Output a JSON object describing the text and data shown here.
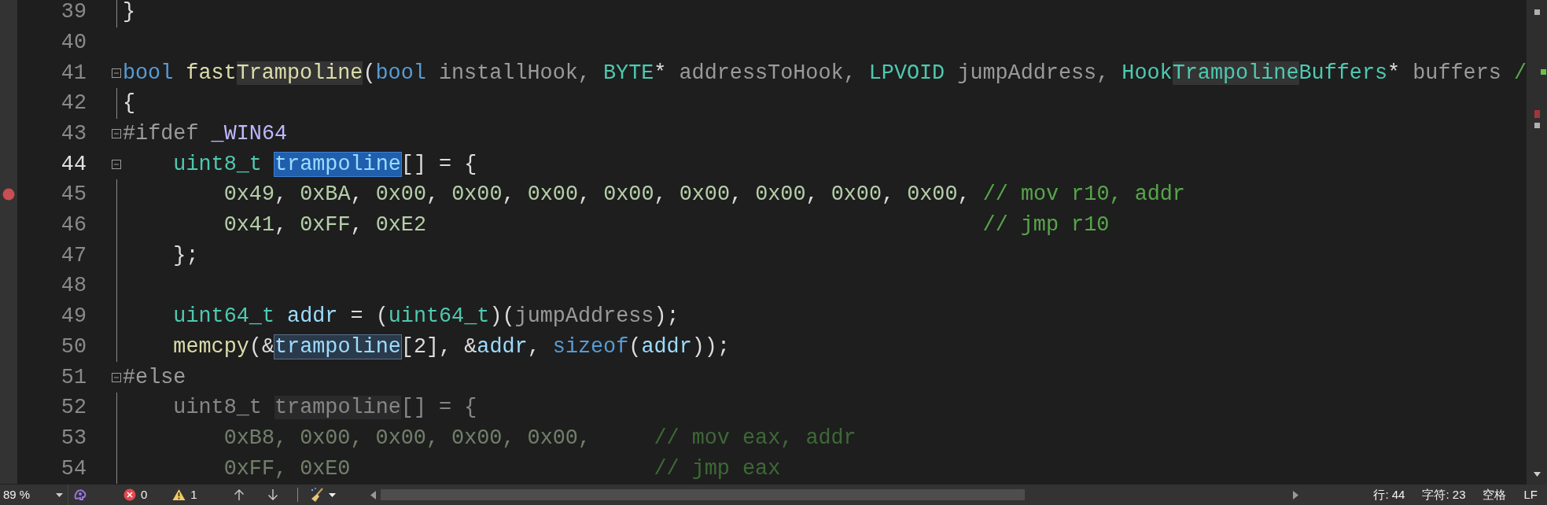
{
  "lines": [
    {
      "number": "39",
      "current": false,
      "breakpoint": false,
      "foldable": false,
      "fold_guide": true,
      "inactive": false,
      "tokens": [
        {
          "text": "}",
          "kind": "plain"
        }
      ]
    },
    {
      "number": "40",
      "current": false,
      "breakpoint": false,
      "foldable": false,
      "fold_guide": false,
      "inactive": false
    },
    {
      "number": "41",
      "current": false,
      "breakpoint": false,
      "foldable": true,
      "fold_guide": false,
      "inactive": false,
      "tokens": [
        {
          "text": "bool",
          "kind": "keyword"
        },
        {
          "text": " fast",
          "kind": "function"
        },
        {
          "text": "Trampoline",
          "kind": "function",
          "matched": true
        },
        {
          "text": "(",
          "kind": "plain"
        },
        {
          "text": "bool",
          "kind": "keyword"
        },
        {
          "text": " installHook, ",
          "kind": "param"
        },
        {
          "text": "BYTE",
          "kind": "type"
        },
        {
          "text": "* ",
          "kind": "plain"
        },
        {
          "text": "addressToHook, ",
          "kind": "param"
        },
        {
          "text": "LPVOID",
          "kind": "type"
        },
        {
          "text": " jumpAddress, ",
          "kind": "param"
        },
        {
          "text": "Hook",
          "kind": "type"
        },
        {
          "text": "Trampoline",
          "kind": "type",
          "matched": true
        },
        {
          "text": "Buffers",
          "kind": "type"
        },
        {
          "text": "* ",
          "kind": "plain"
        },
        {
          "text": "buffers ",
          "kind": "param"
        },
        {
          "text": "/",
          "kind": "comment"
        }
      ]
    },
    {
      "number": "42",
      "current": false,
      "breakpoint": false,
      "foldable": false,
      "fold_guide": true,
      "inactive": false,
      "tokens": [
        {
          "text": "{",
          "kind": "plain"
        }
      ]
    },
    {
      "number": "43",
      "current": false,
      "breakpoint": false,
      "foldable": true,
      "fold_guide": false,
      "inactive": false,
      "tokens": [
        {
          "text": "#ifdef ",
          "kind": "preprocessor"
        },
        {
          "text": "_WIN64",
          "kind": "macro"
        }
      ]
    },
    {
      "number": "44",
      "current": true,
      "breakpoint": false,
      "foldable": true,
      "fold_guide": false,
      "inactive": false,
      "tokens": [
        {
          "text": "    uint8_t ",
          "kind": "type"
        },
        {
          "text": "trampoline",
          "kind": "variable",
          "selected": true
        },
        {
          "text": "[] = {",
          "kind": "plain"
        }
      ]
    },
    {
      "number": "45",
      "current": false,
      "breakpoint": true,
      "foldable": false,
      "fold_guide": true,
      "inactive": false,
      "tokens": [
        {
          "text": "        0x49",
          "kind": "number"
        },
        {
          "text": ", ",
          "kind": "plain"
        },
        {
          "text": "0xBA",
          "kind": "number"
        },
        {
          "text": ", ",
          "kind": "plain"
        },
        {
          "text": "0x00",
          "kind": "number"
        },
        {
          "text": ", ",
          "kind": "plain"
        },
        {
          "text": "0x00",
          "kind": "number"
        },
        {
          "text": ", ",
          "kind": "plain"
        },
        {
          "text": "0x00",
          "kind": "number"
        },
        {
          "text": ", ",
          "kind": "plain"
        },
        {
          "text": "0x00",
          "kind": "number"
        },
        {
          "text": ", ",
          "kind": "plain"
        },
        {
          "text": "0x00",
          "kind": "number"
        },
        {
          "text": ", ",
          "kind": "plain"
        },
        {
          "text": "0x00",
          "kind": "number"
        },
        {
          "text": ", ",
          "kind": "plain"
        },
        {
          "text": "0x00",
          "kind": "number"
        },
        {
          "text": ", ",
          "kind": "plain"
        },
        {
          "text": "0x00",
          "kind": "number"
        },
        {
          "text": ", ",
          "kind": "plain"
        },
        {
          "text": "// mov r10, addr",
          "kind": "comment"
        }
      ]
    },
    {
      "number": "46",
      "current": false,
      "breakpoint": false,
      "foldable": false,
      "fold_guide": true,
      "inactive": false,
      "tokens": [
        {
          "text": "        0x41",
          "kind": "number"
        },
        {
          "text": ", ",
          "kind": "plain"
        },
        {
          "text": "0xFF",
          "kind": "number"
        },
        {
          "text": ", ",
          "kind": "plain"
        },
        {
          "text": "0xE2                                            ",
          "kind": "number"
        },
        {
          "text": "// jmp r10",
          "kind": "comment"
        }
      ]
    },
    {
      "number": "47",
      "current": false,
      "breakpoint": false,
      "foldable": false,
      "fold_guide": true,
      "inactive": false,
      "tokens": [
        {
          "text": "    };",
          "kind": "plain"
        }
      ]
    },
    {
      "number": "48",
      "current": false,
      "breakpoint": false,
      "foldable": false,
      "fold_guide": true,
      "inactive": false
    },
    {
      "number": "49",
      "current": false,
      "breakpoint": false,
      "foldable": false,
      "fold_guide": true,
      "inactive": false,
      "tokens": [
        {
          "text": "    uint64_t ",
          "kind": "type"
        },
        {
          "text": "addr",
          "kind": "variable"
        },
        {
          "text": " = (",
          "kind": "plain"
        },
        {
          "text": "uint64_t",
          "kind": "type"
        },
        {
          "text": ")(",
          "kind": "plain"
        },
        {
          "text": "jumpAddress",
          "kind": "param"
        },
        {
          "text": ");",
          "kind": "plain"
        }
      ]
    },
    {
      "number": "50",
      "current": false,
      "breakpoint": false,
      "foldable": false,
      "fold_guide": true,
      "inactive": false,
      "tokens": [
        {
          "text": "    memcpy",
          "kind": "function"
        },
        {
          "text": "(&",
          "kind": "plain"
        },
        {
          "text": "trampoline",
          "kind": "variable",
          "referenced": true
        },
        {
          "text": "[2], &",
          "kind": "plain"
        },
        {
          "text": "addr",
          "kind": "variable"
        },
        {
          "text": ", ",
          "kind": "plain"
        },
        {
          "text": "sizeof",
          "kind": "keyword"
        },
        {
          "text": "(",
          "kind": "plain"
        },
        {
          "text": "addr",
          "kind": "variable"
        },
        {
          "text": "));",
          "kind": "plain"
        }
      ]
    },
    {
      "number": "51",
      "current": false,
      "breakpoint": false,
      "foldable": true,
      "fold_guide": false,
      "inactive": false,
      "tokens": [
        {
          "text": "#else",
          "kind": "preprocessor"
        }
      ]
    },
    {
      "number": "52",
      "current": false,
      "breakpoint": false,
      "foldable": false,
      "fold_guide": true,
      "inactive": true,
      "tokens": [
        {
          "text": "    uint8_t ",
          "kind": "plain"
        },
        {
          "text": "trampoline",
          "kind": "plain",
          "matched": true
        },
        {
          "text": "[] = {",
          "kind": "plain"
        }
      ]
    },
    {
      "number": "53",
      "current": false,
      "breakpoint": false,
      "foldable": false,
      "fold_guide": true,
      "inactive": true,
      "tokens": [
        {
          "text": "        0xB8, 0x00, 0x00, 0x00, 0x00,     ",
          "kind": "number"
        },
        {
          "text": "// mov eax, addr",
          "kind": "comment"
        }
      ]
    },
    {
      "number": "54",
      "current": false,
      "breakpoint": false,
      "foldable": false,
      "fold_guide": true,
      "inactive": true,
      "tokens": [
        {
          "text": "        0xFF, 0xE0                        ",
          "kind": "number"
        },
        {
          "text": "// jmp eax",
          "kind": "comment"
        }
      ]
    }
  ],
  "status_bar": {
    "zoom": "89 %",
    "errors": "0",
    "warnings": "1",
    "line": "行: 44",
    "column": "字符: 23",
    "indent": "空格",
    "line_ending": "LF"
  }
}
